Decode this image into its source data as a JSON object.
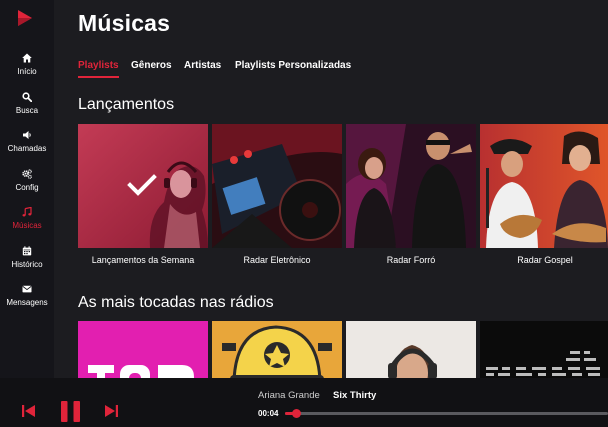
{
  "sidebar": {
    "items": [
      {
        "label": "Início",
        "icon": "home-icon"
      },
      {
        "label": "Busca",
        "icon": "search-icon"
      },
      {
        "label": "Chamadas",
        "icon": "speaker-icon"
      },
      {
        "label": "Config",
        "icon": "gears-icon"
      },
      {
        "label": "Músicas",
        "icon": "music-note-icon"
      },
      {
        "label": "Histórico",
        "icon": "calendar-icon"
      },
      {
        "label": "Mensagens",
        "icon": "envelope-icon"
      }
    ],
    "active_index": 4
  },
  "header": {
    "title": "Músicas"
  },
  "tabs": [
    {
      "label": "Playlists"
    },
    {
      "label": "Gêneros"
    },
    {
      "label": "Artistas"
    },
    {
      "label": "Playlists Personalizadas"
    }
  ],
  "sections": [
    {
      "title": "Lançamentos",
      "cards": [
        {
          "label": "Lançamentos da Semana",
          "selected": true
        },
        {
          "label": "Radar Eletrônico"
        },
        {
          "label": "Radar Forró"
        },
        {
          "label": "Radar Gospel"
        }
      ]
    },
    {
      "title": "As mais tocadas nas rádios",
      "cards": [
        {
          "label": ""
        },
        {
          "label": ""
        },
        {
          "label": ""
        },
        {
          "label": ""
        }
      ]
    }
  ],
  "player": {
    "artist": "Ariana Grande",
    "title": "Six Thirty",
    "elapsed": "00:04",
    "progress_fraction": 0.035
  },
  "colors": {
    "accent": "#e0243a",
    "background": "#1c1c20",
    "sidebar": "#15151a",
    "player": "#111114"
  }
}
